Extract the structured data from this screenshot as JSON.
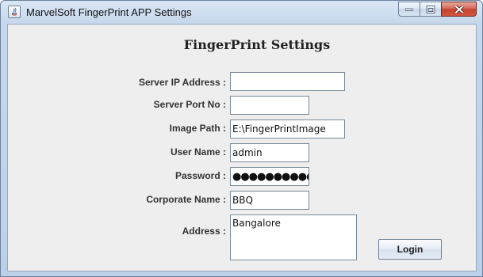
{
  "window": {
    "title": "MarvelSoft FingerPrint APP Settings",
    "buttons": [
      "minimize",
      "maximize",
      "close"
    ]
  },
  "form": {
    "heading": "FingerPrint Settings",
    "server_ip_label": "Server IP Address :",
    "server_ip_value": "",
    "server_port_label": "Server Port No :",
    "server_port_value": "",
    "image_path_label": "Image Path :",
    "image_path_value": "E:\\FingerPrintImage",
    "user_name_label": "User Name :",
    "user_name_value": "admin",
    "password_label": "Password :",
    "password_value": "●●●●●●●●●●",
    "corporate_name_label": "Corporate Name :",
    "corporate_name_value": "BBQ",
    "address_label": "Address :",
    "address_value": "Bangalore",
    "login_label": "Login"
  }
}
